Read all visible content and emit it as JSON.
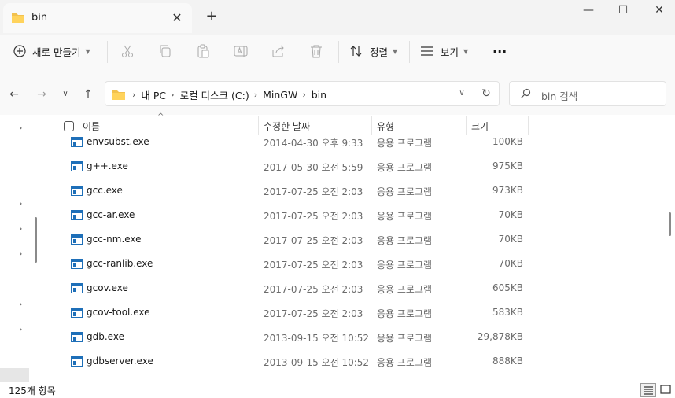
{
  "window": {
    "tab_title": "bin",
    "new_tab_symbol": "+",
    "close_tab_symbol": "✕",
    "minimize_symbol": "—",
    "maximize_symbol": "☐",
    "close_symbol": "✕"
  },
  "toolbar": {
    "new_label": "새로 만들기",
    "sort_label": "정렬",
    "view_label": "보기",
    "more_symbol": "···",
    "icons": [
      "cut-icon",
      "copy-icon",
      "paste-icon",
      "rename-icon",
      "share-icon",
      "delete-icon"
    ]
  },
  "address": {
    "crumbs": [
      "내 PC",
      "로컬 디스크 (C:)",
      "MinGW",
      "bin"
    ]
  },
  "search": {
    "placeholder": "bin 검색"
  },
  "columns": {
    "name": "이름",
    "date": "수정한 날짜",
    "type": "유형",
    "size": "크기"
  },
  "files": [
    {
      "name": "envsubst.exe",
      "date": "2014-04-30 오후 9:33",
      "type": "응용 프로그램",
      "size": "100KB"
    },
    {
      "name": "g++.exe",
      "date": "2017-05-30 오전 5:59",
      "type": "응용 프로그램",
      "size": "975KB"
    },
    {
      "name": "gcc.exe",
      "date": "2017-07-25 오전 2:03",
      "type": "응용 프로그램",
      "size": "973KB"
    },
    {
      "name": "gcc-ar.exe",
      "date": "2017-07-25 오전 2:03",
      "type": "응용 프로그램",
      "size": "70KB"
    },
    {
      "name": "gcc-nm.exe",
      "date": "2017-07-25 오전 2:03",
      "type": "응용 프로그램",
      "size": "70KB"
    },
    {
      "name": "gcc-ranlib.exe",
      "date": "2017-07-25 오전 2:03",
      "type": "응용 프로그램",
      "size": "70KB"
    },
    {
      "name": "gcov.exe",
      "date": "2017-07-25 오전 2:03",
      "type": "응용 프로그램",
      "size": "605KB"
    },
    {
      "name": "gcov-tool.exe",
      "date": "2017-07-25 오전 2:03",
      "type": "응용 프로그램",
      "size": "583KB"
    },
    {
      "name": "gdb.exe",
      "date": "2013-09-15 오전 10:52",
      "type": "응용 프로그램",
      "size": "29,878KB"
    },
    {
      "name": "gdbserver.exe",
      "date": "2013-09-15 오전 10:52",
      "type": "응용 프로그램",
      "size": "888KB"
    }
  ],
  "status": {
    "item_count": "125개 항목"
  },
  "colors": {
    "accent": "#1e6fb8",
    "folder": "#f2c14e"
  }
}
